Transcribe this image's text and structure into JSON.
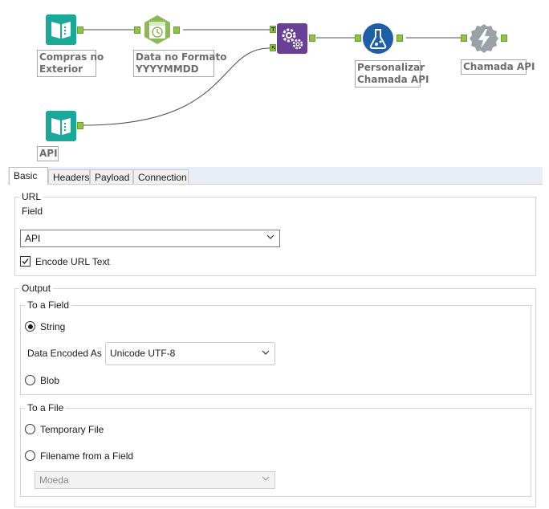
{
  "workflow": {
    "tools": [
      {
        "id": "input1",
        "label": "Compras no\nExterior",
        "icon": "book-input-icon"
      },
      {
        "id": "datetime",
        "label": "Data no Formato\nYYYYMMDD",
        "icon": "clock-icon"
      },
      {
        "id": "append",
        "label": "",
        "icon": "gears-icon",
        "anchors": [
          "T",
          "S"
        ]
      },
      {
        "id": "formula",
        "label": "Personalizar\nChamada API",
        "icon": "flask-icon"
      },
      {
        "id": "download",
        "label": "Chamada API",
        "icon": "lightning-icon"
      },
      {
        "id": "input2",
        "label": "API",
        "icon": "book-input-icon"
      }
    ],
    "colors": {
      "input": "#1aa899",
      "datetime": "#8db85a",
      "append": "#6a3f96",
      "formula": "#1d5fa8",
      "download": "#9aa1a7",
      "anchor": "#8cc63f",
      "connection": "#4d4d4d"
    }
  },
  "config": {
    "tabs": [
      "Basic",
      "Headers",
      "Payload",
      "Connection"
    ],
    "active_tab": "Basic",
    "url": {
      "legend": "URL",
      "field_label": "Field",
      "field_value": "API",
      "encode_label": "Encode URL Text",
      "encode_checked": true
    },
    "output": {
      "legend": "Output",
      "to_field": {
        "legend": "To a Field",
        "string_label": "String",
        "string_checked": true,
        "encoding_label": "Data Encoded As",
        "encoding_value": "Unicode UTF-8",
        "blob_label": "Blob",
        "blob_checked": false
      },
      "to_file": {
        "legend": "To a File",
        "temp_label": "Temporary File",
        "temp_checked": false,
        "filename_label": "Filename from a Field",
        "filename_checked": false,
        "filename_value": "Moeda"
      }
    }
  }
}
